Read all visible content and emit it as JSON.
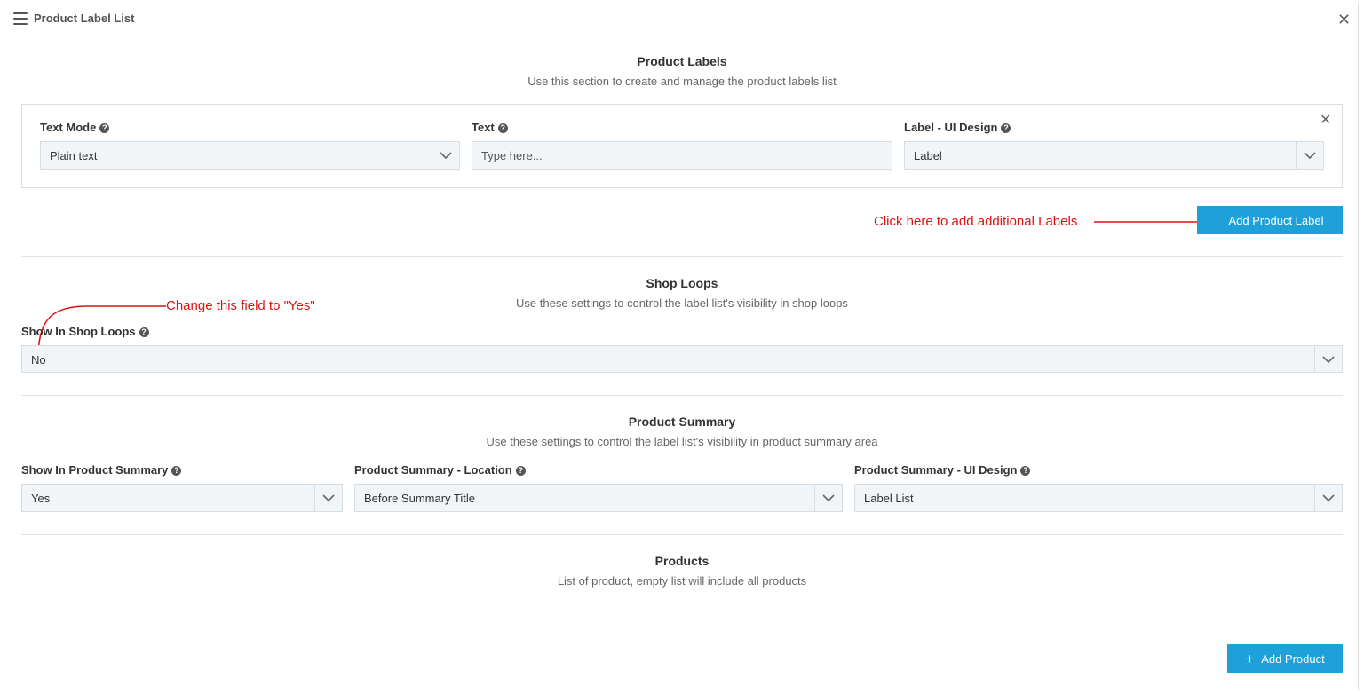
{
  "panel": {
    "title": "Product Label List"
  },
  "product_labels": {
    "title": "Product Labels",
    "subtitle": "Use this section to create and manage the product labels list",
    "text_mode": {
      "label": "Text Mode",
      "value": "Plain text"
    },
    "text": {
      "label": "Text",
      "placeholder": "Type here..."
    },
    "ui_design": {
      "label": "Label - UI Design",
      "value": "Label"
    },
    "add_button": "Add Product Label"
  },
  "shop_loops": {
    "title": "Shop Loops",
    "subtitle": "Use these settings to control the label list's visibility in shop loops",
    "show": {
      "label": "Show In Shop Loops",
      "value": "No"
    }
  },
  "product_summary": {
    "title": "Product Summary",
    "subtitle": "Use these settings to control the label list's visibility in product summary area",
    "show": {
      "label": "Show In Product Summary",
      "value": "Yes"
    },
    "location": {
      "label": "Product Summary - Location",
      "value": "Before Summary Title"
    },
    "ui_design": {
      "label": "Product Summary - UI Design",
      "value": "Label List"
    }
  },
  "products": {
    "title": "Products",
    "subtitle": "List of product, empty list will include all products",
    "add_button": "Add Product"
  },
  "annotations": {
    "add_labels": "Click here to add additional Labels",
    "change_field": "Change this field to \"Yes\""
  },
  "colors": {
    "accent": "#1ea0d8",
    "annotation": "#e01010",
    "field_bg": "#f1f5f8"
  }
}
